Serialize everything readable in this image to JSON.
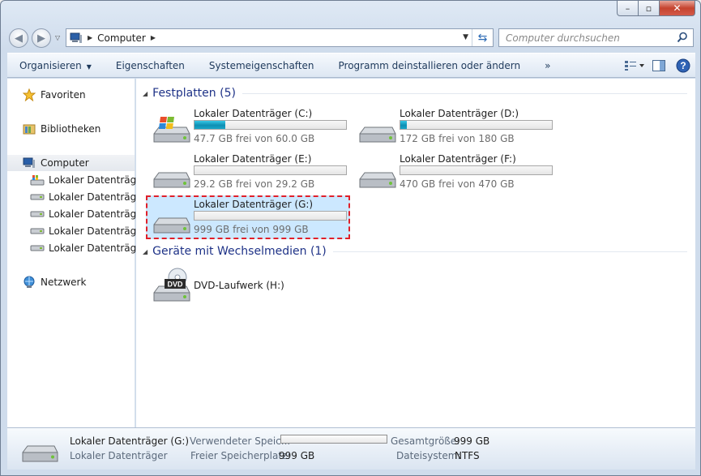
{
  "window": {
    "min_glyph": "–",
    "max_glyph": "▫",
    "close_glyph": "✕"
  },
  "address": {
    "crumb": "Computer",
    "search_placeholder": "Computer durchsuchen"
  },
  "toolbar": {
    "organize": "Organisieren",
    "properties": "Eigenschaften",
    "system_properties": "Systemeigenschaften",
    "uninstall": "Programm deinstallieren oder ändern",
    "more": "»"
  },
  "sidebar": {
    "favorites": "Favoriten",
    "libraries": "Bibliotheken",
    "computer": "Computer",
    "drives": [
      "Lokaler Datenträger",
      "Lokaler Datenträger",
      "Lokaler Datenträger",
      "Lokaler Datenträger",
      "Lokaler Datenträger"
    ],
    "network": "Netzwerk"
  },
  "groups": {
    "hard_disks": "Festplatten (5)",
    "removable": "Geräte mit Wechselmedien (1)"
  },
  "drives": [
    {
      "name": "Lokaler Datenträger (C:)",
      "size": "47.7 GB frei von 60.0 GB",
      "used_fraction": 0.205,
      "windows": true
    },
    {
      "name": "Lokaler Datenträger (D:)",
      "size": "172 GB frei von 180 GB",
      "used_fraction": 0.044
    },
    {
      "name": "Lokaler Datenträger (E:)",
      "size": "29.2 GB frei von 29.2 GB",
      "used_fraction": 0
    },
    {
      "name": "Lokaler Datenträger (F:)",
      "size": "470 GB frei von 470 GB",
      "used_fraction": 0
    },
    {
      "name": "Lokaler Datenträger (G:)",
      "size": "999 GB frei von 999 GB",
      "used_fraction": 0,
      "selected": true
    }
  ],
  "dvd": {
    "name": "DVD-Laufwerk (H:)",
    "badge": "DVD"
  },
  "details": {
    "name": "Lokaler Datenträger (G:)",
    "type": "Lokaler Datenträger",
    "used_label": "Verwendeter Speic...",
    "free_label": "Freier Speicherplatz:",
    "free_value": "999 GB",
    "total_label": "Gesamtgröße:",
    "total_value": "999 GB",
    "fs_label": "Dateisystem:",
    "fs_value": "NTFS",
    "used_fraction": 0
  },
  "colors": {
    "group_title": "#1e3287",
    "selection": "#cce8ff",
    "highlight_dash": "#e0202a",
    "bar_fill": "#1aa6c8"
  }
}
